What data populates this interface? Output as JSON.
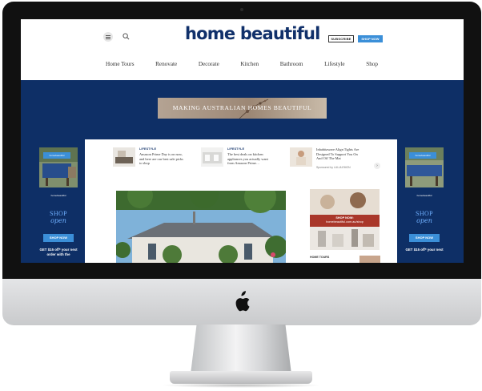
{
  "site": {
    "logo_word1": "home",
    "logo_word2": "beautiful",
    "subscribe_label": "SUBSCRIBE",
    "shop_now_label": "SHOP NOW"
  },
  "nav": {
    "items": [
      "Home Tours",
      "Renovate",
      "Decorate",
      "Kitchen",
      "Bathroom",
      "Lifestyle",
      "Shop"
    ]
  },
  "banner": {
    "text": "MAKING AUSTRALIAN HOMES BEAUTIFUL"
  },
  "stories": [
    {
      "category": "LIFESTYLE",
      "text": "Amazon Prime Day is on now, and here are our best sale picks to shop",
      "sponsor": ""
    },
    {
      "category": "LIFESTYLE",
      "text": "The best deals on kitchen appliances you actually want from Amazon Prime…",
      "sponsor": ""
    },
    {
      "category": "",
      "text": "Inhabitaware Align Tights Are Designed To Support You On And Off The Mat",
      "sponsor": "Sponsored by LULULEMON"
    }
  ],
  "next_arrow": "›",
  "right_ad": {
    "line1": "SHOP NOW:",
    "line2": "homebeautiful.com.au/shop"
  },
  "home_tours_label": "HOME TOURS",
  "side_ads": {
    "tag": "homebeautiful",
    "brand": "homebeautiful",
    "shop": "SHOP",
    "open": "open",
    "button": "SHOP NOW",
    "left_offer": "GET $15 off* your next order with the",
    "right_offer": "GET $15 off* your next"
  },
  "colors": {
    "brand_navy": "#0e2f66",
    "accent_blue": "#3b8fd8"
  }
}
